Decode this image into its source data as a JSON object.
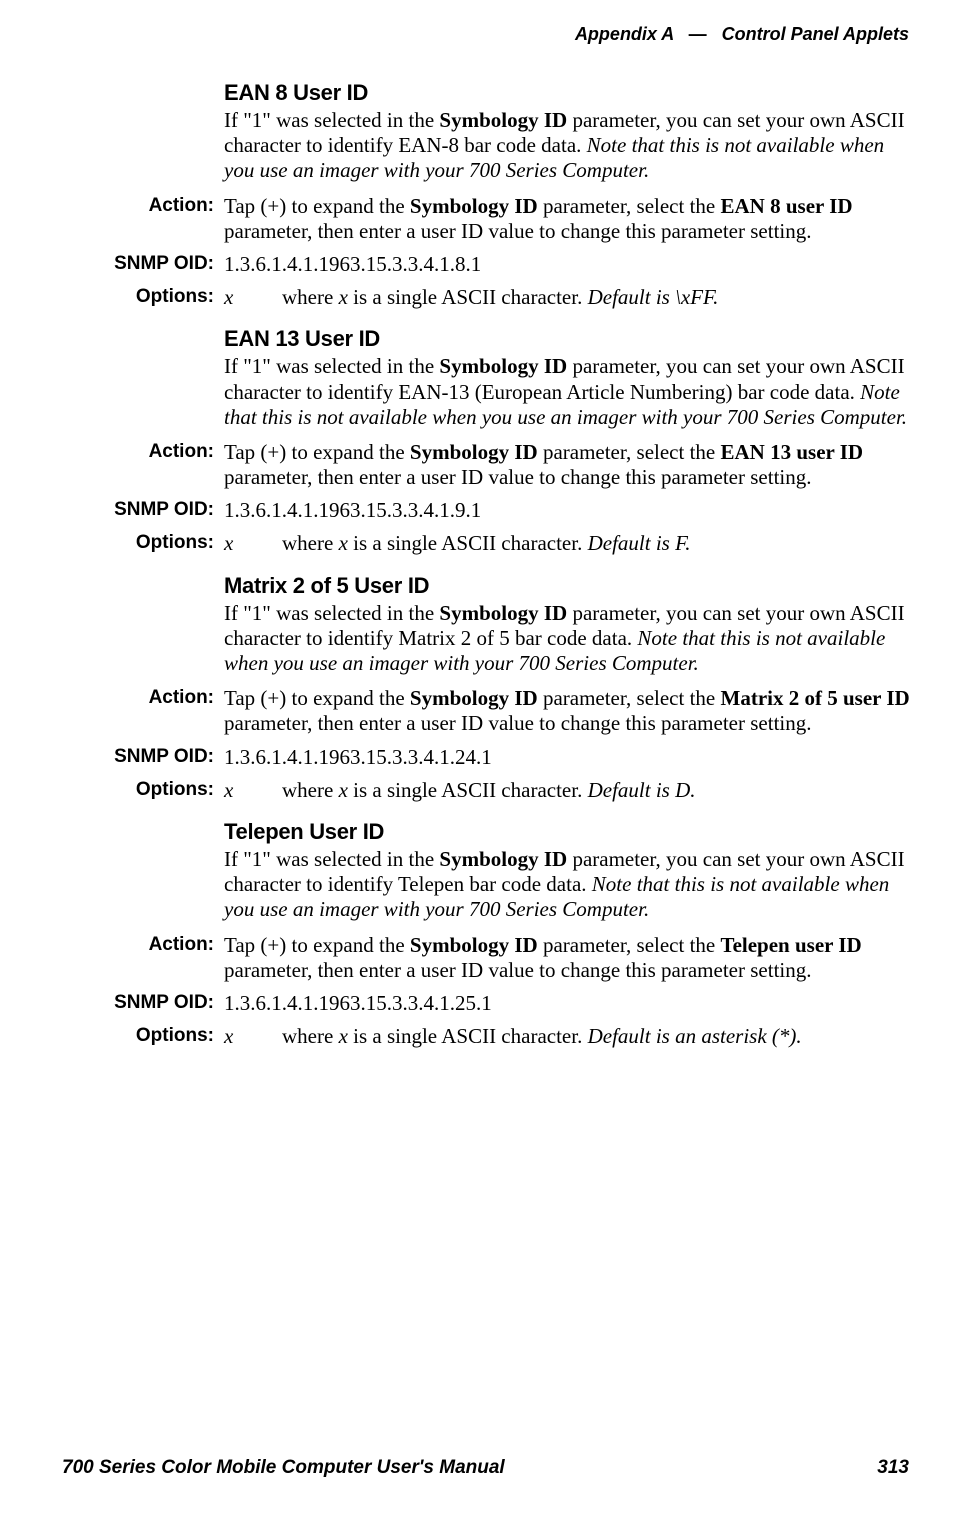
{
  "header": {
    "appendix": "Appendix A",
    "dash": "—",
    "title": "Control Panel Applets"
  },
  "labels": {
    "action": "Action:",
    "snmp": "SNMP OID:",
    "options": "Options:",
    "x": "x"
  },
  "sections": [
    {
      "title": "EAN 8 User ID",
      "intro_pre": "If \"1\" was selected in the ",
      "intro_b1": "Symbology ID",
      "intro_mid": " parameter, you can set your own ASCII character to identify EAN-8 bar code data. ",
      "intro_ital": "Note that this is not available when you use an imager with your 700 Series Computer.",
      "action_pre": "Tap (+) to expand the ",
      "action_b1": "Symbology ID",
      "action_mid": " parameter, select the ",
      "action_b2": "EAN 8 user ID",
      "action_post": " parameter, then enter a user ID value to change this parameter setting.",
      "snmp": "1.3.6.1.4.1.1963.15.3.3.4.1.8.1",
      "options_pre": "where ",
      "options_i": "x",
      "options_mid": " is a single ASCII character. ",
      "options_default": "Default is \\xFF."
    },
    {
      "title": "EAN 13 User ID",
      "intro_pre": "If \"1\" was selected in the ",
      "intro_b1": "Symbology ID",
      "intro_mid": " parameter, you can set your own ASCII character to identify EAN-13 (European Article Numbering) bar code data. ",
      "intro_ital": "Note that this is not available when you use an imager with your 700 Series Computer.",
      "action_pre": "Tap (+) to expand the ",
      "action_b1": "Symbology ID",
      "action_mid": " parameter, select the ",
      "action_b2": "EAN 13 user ID",
      "action_post": " parameter, then enter a user ID value to change this parameter setting.",
      "snmp": "1.3.6.1.4.1.1963.15.3.3.4.1.9.1",
      "options_pre": "where ",
      "options_i": "x",
      "options_mid": " is a single ASCII character. ",
      "options_default": "Default is F."
    },
    {
      "title": "Matrix 2 of 5 User ID",
      "intro_pre": "If \"1\" was selected in the ",
      "intro_b1": "Symbology ID",
      "intro_mid": " parameter, you can set your own ASCII character to identify Matrix 2 of 5 bar code data. ",
      "intro_ital": "Note that this is not available when you use an imager with your 700 Series Computer.",
      "action_pre": "Tap (+) to expand the ",
      "action_b1": "Symbology ID",
      "action_mid": " parameter, select the ",
      "action_b2": "Matrix 2 of 5 user ID",
      "action_post": " parameter, then enter a user ID value to change this parameter setting.",
      "snmp": "1.3.6.1.4.1.1963.15.3.3.4.1.24.1",
      "options_pre": "where ",
      "options_i": "x",
      "options_mid": " is a single ASCII character. ",
      "options_default": "Default is D."
    },
    {
      "title": "Telepen User ID",
      "intro_pre": "If \"1\" was selected in the ",
      "intro_b1": "Symbology ID",
      "intro_mid": " parameter, you can set your own ASCII character to identify Telepen bar code data. ",
      "intro_ital": "Note that this is not available when you use an imager with your 700 Series Computer.",
      "action_pre": "Tap (+) to expand the ",
      "action_b1": "Symbology ID",
      "action_mid": " parameter, select the ",
      "action_b2": "Telepen user ID",
      "action_post": " parameter, then enter a user ID value to change this parameter setting.",
      "snmp": "1.3.6.1.4.1.1963.15.3.3.4.1.25.1",
      "options_pre": "where ",
      "options_i": "x",
      "options_mid": " is a single ASCII character. ",
      "options_default": "Default is an asterisk (*)."
    }
  ],
  "footer": {
    "left": "700 Series Color Mobile Computer User's Manual",
    "right": "313"
  }
}
